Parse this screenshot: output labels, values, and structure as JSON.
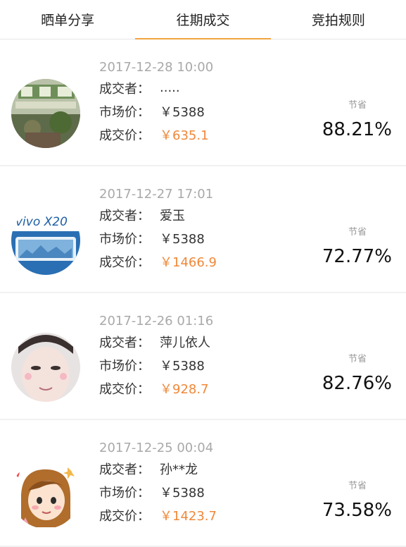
{
  "tabs": [
    {
      "label": "晒单分享"
    },
    {
      "label": "往期成交"
    },
    {
      "label": "竞拍规则"
    }
  ],
  "labels": {
    "winner": "成交者：",
    "market": "市场价：",
    "deal": "成交价：",
    "save": "节省"
  },
  "items": [
    {
      "date": "2017-12-28 10:00",
      "winner": ".....",
      "market": "￥5388",
      "deal": "￥635.1",
      "percent": "88.21%",
      "avatar": "storefront-photo"
    },
    {
      "date": "2017-12-27 17:01",
      "winner": "爱玉",
      "market": "￥5388",
      "deal": "￥1466.9",
      "percent": "72.77%",
      "avatar": "vivo-x20-phone"
    },
    {
      "date": "2017-12-26 01:16",
      "winner": "萍儿依人",
      "market": "￥5388",
      "deal": "￥928.7",
      "percent": "82.76%",
      "avatar": "face-photo"
    },
    {
      "date": "2017-12-25 00:04",
      "winner": "孙**龙",
      "market": "￥5388",
      "deal": "￥1423.7",
      "percent": "73.58%",
      "avatar": "cartoon-girl"
    }
  ],
  "colors": {
    "accent": "#f0a33c",
    "deal_price": "#f0883a"
  }
}
